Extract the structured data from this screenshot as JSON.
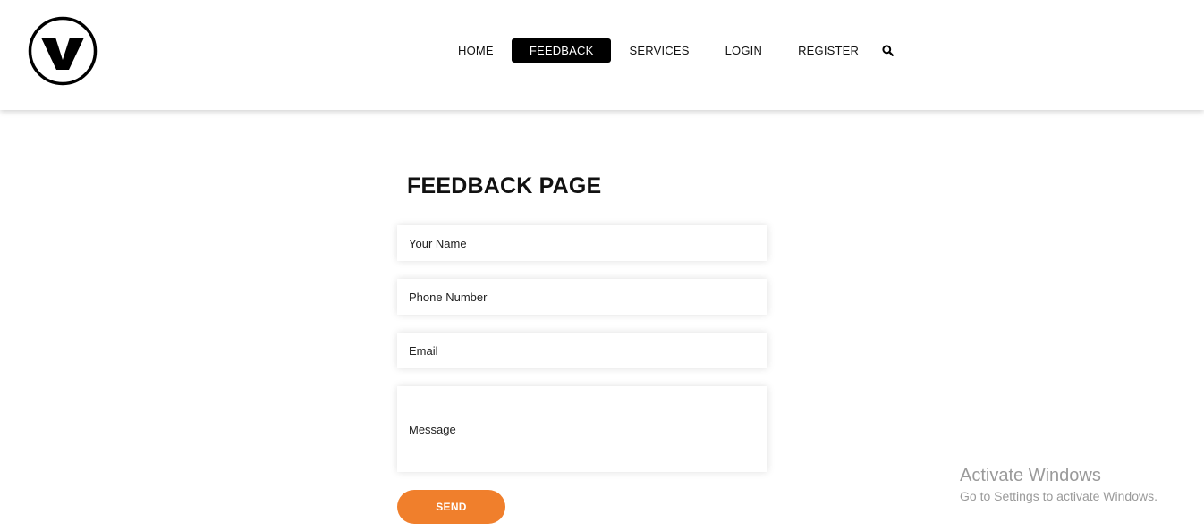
{
  "brand": {
    "logo_icon": "v-logo-icon"
  },
  "nav": {
    "items": [
      {
        "label": "HOME",
        "active": false
      },
      {
        "label": "FEEDBACK",
        "active": true
      },
      {
        "label": "SERVICES",
        "active": false
      },
      {
        "label": "LOGIN",
        "active": false
      },
      {
        "label": "REGISTER",
        "active": false
      }
    ],
    "search_icon": "search-icon"
  },
  "page": {
    "title": "FEEDBACK PAGE"
  },
  "form": {
    "name_placeholder": "Your Name",
    "phone_placeholder": "Phone Number",
    "email_placeholder": "Email",
    "message_placeholder": "Message",
    "send_label": "SEND"
  },
  "watermark": {
    "title": "Activate Windows",
    "subtitle": "Go to Settings to activate Windows."
  },
  "colors": {
    "accent": "#f07f2c",
    "nav_active_bg": "#000000",
    "watermark_text": "#9a9a9a"
  }
}
